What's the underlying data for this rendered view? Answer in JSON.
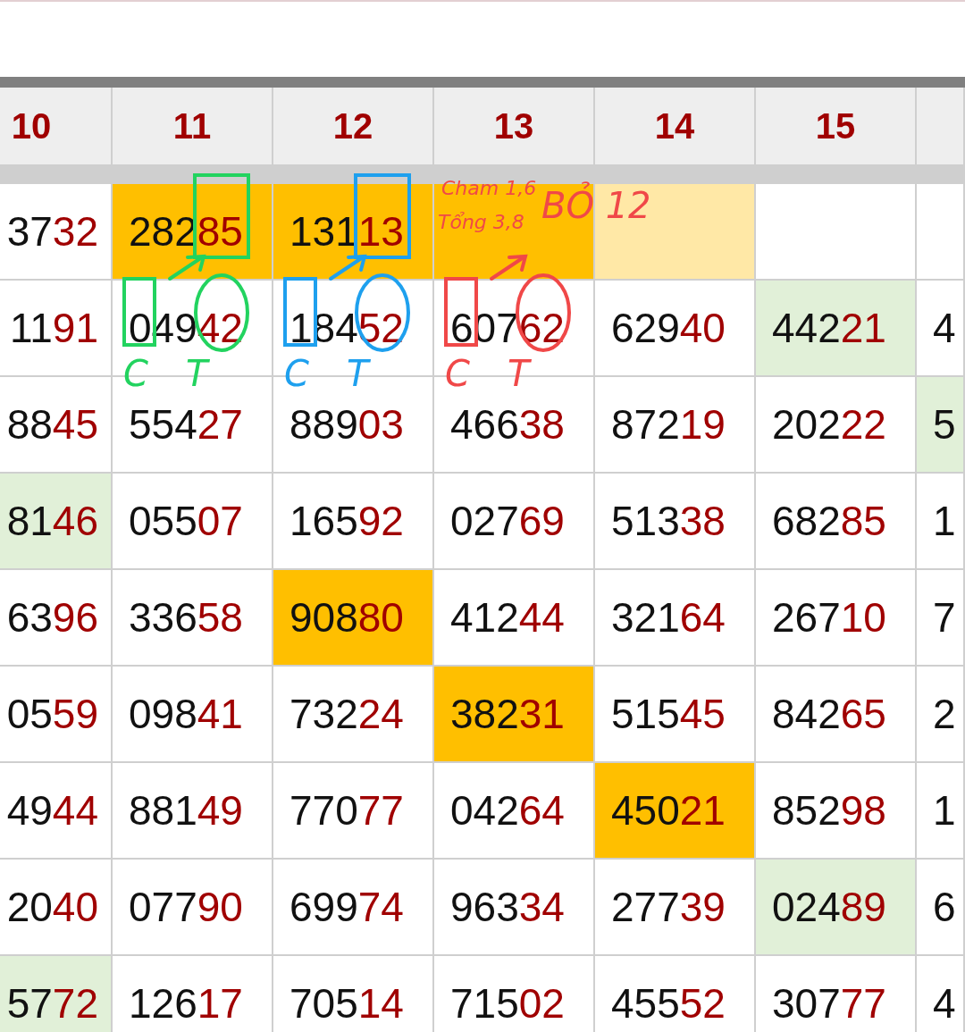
{
  "table": {
    "columns": [
      "10",
      "11",
      "12",
      "13",
      "14",
      "15"
    ],
    "rows": [
      {
        "cells": [
          {
            "lead": "37",
            "tail": "32"
          },
          {
            "lead": "282",
            "tail": "85",
            "color": "#ffbf00"
          },
          {
            "lead": "131",
            "tail": "13",
            "color": "#ffbf00"
          },
          {
            "color": "#ffbf00"
          },
          {
            "color": "#ffe8a6"
          },
          {},
          {}
        ]
      },
      {
        "cells": [
          {
            "lead": "11",
            "tail": "91"
          },
          {
            "lead": "049",
            "tail": "42"
          },
          {
            "lead": "184",
            "tail": "52"
          },
          {
            "lead": "607",
            "tail": "62"
          },
          {
            "lead": "629",
            "tail": "40"
          },
          {
            "lead": "442",
            "tail": "21",
            "color": "#e1f0d8"
          },
          {
            "lead": "4"
          }
        ]
      },
      {
        "cells": [
          {
            "lead": "88",
            "tail": "45"
          },
          {
            "lead": "554",
            "tail": "27"
          },
          {
            "lead": "889",
            "tail": "03"
          },
          {
            "lead": "466",
            "tail": "38"
          },
          {
            "lead": "872",
            "tail": "19"
          },
          {
            "lead": "202",
            "tail": "22"
          },
          {
            "lead": "5",
            "color": "#e1f0d8"
          }
        ]
      },
      {
        "cells": [
          {
            "lead": "81",
            "tail": "46",
            "color": "#e1f0d8"
          },
          {
            "lead": "055",
            "tail": "07"
          },
          {
            "lead": "165",
            "tail": "92"
          },
          {
            "lead": "027",
            "tail": "69"
          },
          {
            "lead": "513",
            "tail": "38"
          },
          {
            "lead": "682",
            "tail": "85"
          },
          {
            "lead": "1"
          }
        ]
      },
      {
        "cells": [
          {
            "lead": "63",
            "tail": "96"
          },
          {
            "lead": "336",
            "tail": "58"
          },
          {
            "lead": "908",
            "tail": "80",
            "color": "#ffbf00"
          },
          {
            "lead": "412",
            "tail": "44"
          },
          {
            "lead": "321",
            "tail": "64"
          },
          {
            "lead": "267",
            "tail": "10"
          },
          {
            "lead": "7"
          }
        ]
      },
      {
        "cells": [
          {
            "lead": "05",
            "tail": "59"
          },
          {
            "lead": "098",
            "tail": "41"
          },
          {
            "lead": "732",
            "tail": "24"
          },
          {
            "lead": "382",
            "tail": "31",
            "color": "#ffbf00"
          },
          {
            "lead": "515",
            "tail": "45"
          },
          {
            "lead": "842",
            "tail": "65"
          },
          {
            "lead": "2"
          }
        ]
      },
      {
        "cells": [
          {
            "lead": "49",
            "tail": "44"
          },
          {
            "lead": "881",
            "tail": "49"
          },
          {
            "lead": "770",
            "tail": "77"
          },
          {
            "lead": "042",
            "tail": "64"
          },
          {
            "lead": "450",
            "tail": "21",
            "color": "#ffbf00"
          },
          {
            "lead": "852",
            "tail": "98"
          },
          {
            "lead": "1"
          }
        ]
      },
      {
        "cells": [
          {
            "lead": "20",
            "tail": "40"
          },
          {
            "lead": "077",
            "tail": "90"
          },
          {
            "lead": "699",
            "tail": "74"
          },
          {
            "lead": "963",
            "tail": "34"
          },
          {
            "lead": "277",
            "tail": "39"
          },
          {
            "lead": "024",
            "tail": "89",
            "color": "#e1f0d8"
          },
          {
            "lead": "6"
          }
        ]
      },
      {
        "cells": [
          {
            "lead": "57",
            "tail": "72",
            "color": "#e1f0d8"
          },
          {
            "lead": "126",
            "tail": "17"
          },
          {
            "lead": "705",
            "tail": "14"
          },
          {
            "lead": "715",
            "tail": "02"
          },
          {
            "lead": "455",
            "tail": "52"
          },
          {
            "lead": "307",
            "tail": "77"
          },
          {
            "lead": "4"
          }
        ]
      }
    ]
  },
  "annotations": [
    {
      "color": "#22d35f",
      "labels": [
        "C",
        "T"
      ]
    },
    {
      "color": "#1ea0ee",
      "labels": [
        "C",
        "T"
      ]
    },
    {
      "color": "#f04848",
      "labels": [
        "C",
        "T"
      ],
      "notes": [
        "Cham 1,6",
        "Tổng 3,8",
        "BỎ 12"
      ]
    }
  ]
}
